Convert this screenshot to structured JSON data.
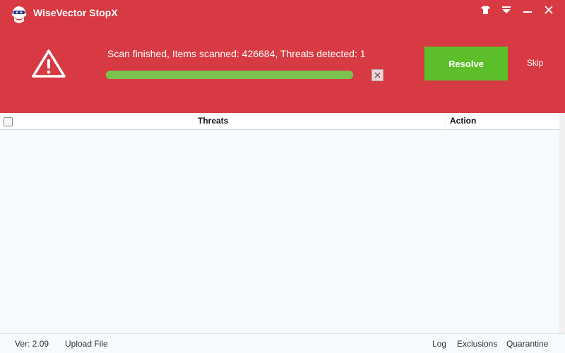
{
  "app": {
    "title": "WiseVector StopX"
  },
  "colors": {
    "header_bg": "#d73a42",
    "progress_fill": "#7cc24f",
    "resolve_bg": "#5cbf2a"
  },
  "icons": {
    "logo": "robot-logo-icon",
    "skin": "tshirt-icon",
    "menu": "dropdown-triangle-icon",
    "minimize": "minimize-icon",
    "close": "close-icon",
    "warning": "warning-triangle-icon",
    "cancel_scan": "close-small-icon"
  },
  "scan": {
    "status": "Scan finished, Items scanned: 426684, Threats detected: 1",
    "progress_percent": 100
  },
  "actions": {
    "resolve": "Resolve",
    "skip": "Skip"
  },
  "table": {
    "col_threats": "Threats",
    "col_action": "Action",
    "rows": []
  },
  "footer": {
    "version": "Ver: 2.09",
    "upload": "Upload File",
    "log": "Log",
    "exclusions": "Exclusions",
    "quarantine": "Quarantine"
  }
}
